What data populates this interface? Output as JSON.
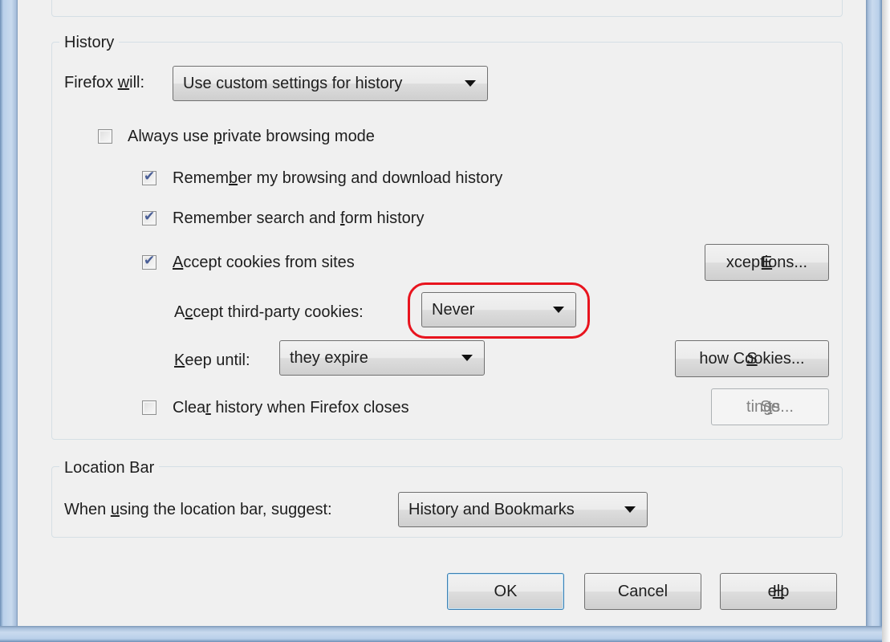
{
  "history": {
    "group_title": "History",
    "firefox_will": {
      "label_pre": "Firefox ",
      "label_u": "w",
      "label_post": "ill:",
      "selected": "Use custom settings for history"
    },
    "private_mode": {
      "label_pre": "Always use ",
      "label_u": "p",
      "label_post": "rivate browsing mode",
      "checked": false
    },
    "remember_browsing": {
      "label_pre": "Remem",
      "label_u": "b",
      "label_post": "er my browsing and download history",
      "checked": true
    },
    "remember_search": {
      "label_pre": "Remember search and ",
      "label_u": "f",
      "label_post": "orm history",
      "checked": true
    },
    "accept_cookies": {
      "label_pre": "",
      "label_u": "A",
      "label_post": "ccept cookies from sites",
      "checked": true
    },
    "exceptions_button": {
      "pre": "",
      "u": "E",
      "post": "xceptions..."
    },
    "third_party": {
      "label_pre": "A",
      "label_u": "c",
      "label_post": "cept third-party cookies:",
      "selected": "Never"
    },
    "keep_until": {
      "label_pre": "",
      "label_u": "K",
      "label_post": "eep until:",
      "selected": "they expire"
    },
    "show_cookies_button": {
      "pre": "",
      "u": "S",
      "post": "how Cookies..."
    },
    "clear_history": {
      "label_pre": "Clea",
      "label_u": "r",
      "label_post": " history when Firefox closes",
      "checked": false
    },
    "settings_button": {
      "pre": "Se",
      "u": "t",
      "post": "tings..."
    }
  },
  "location_bar": {
    "group_title": "Location Bar",
    "suggest": {
      "label_pre": "When ",
      "label_u": "u",
      "label_post": "sing the location bar, suggest:",
      "selected": "History and Bookmarks"
    }
  },
  "footer": {
    "ok": "OK",
    "cancel": "Cancel",
    "help_pre": "",
    "help_u": "H",
    "help_post": "elp"
  },
  "colors": {
    "highlight": "#e8141e",
    "checkmark": "#4a5f97",
    "window_bg": "#f0f0f0"
  }
}
